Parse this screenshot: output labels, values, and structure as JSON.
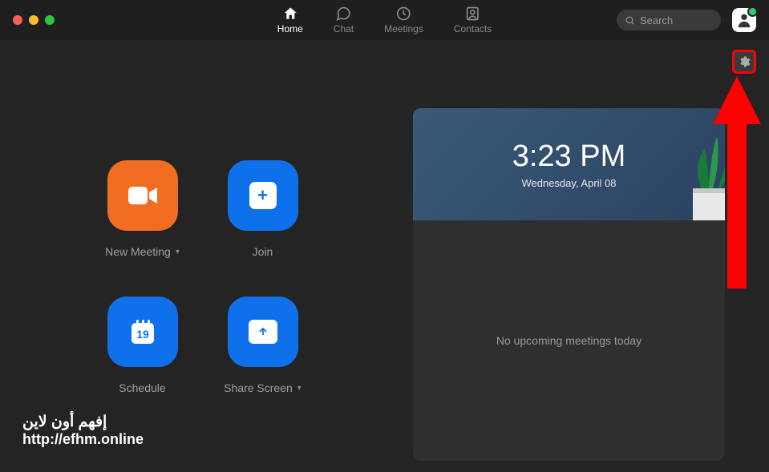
{
  "nav": {
    "home": "Home",
    "chat": "Chat",
    "meetings": "Meetings",
    "contacts": "Contacts"
  },
  "search": {
    "placeholder": "Search"
  },
  "actions": {
    "new_meeting": "New Meeting",
    "join": "Join",
    "schedule": "Schedule",
    "schedule_day": "19",
    "share_screen": "Share Screen"
  },
  "card": {
    "time": "3:23 PM",
    "date": "Wednesday, April 08",
    "empty": "No upcoming meetings today"
  },
  "watermark": {
    "line1": "إفهم أون لاين",
    "line2": "http://efhm.online"
  }
}
